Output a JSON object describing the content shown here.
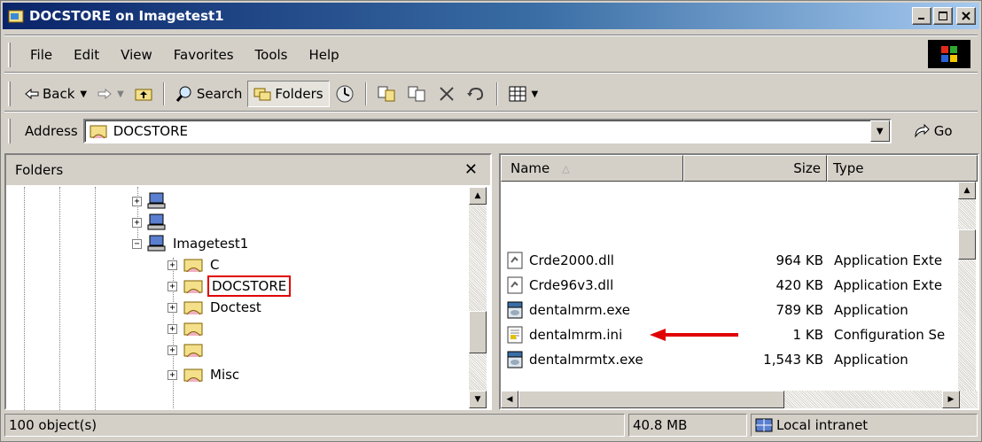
{
  "window": {
    "title": "DOCSTORE on Imagetest1"
  },
  "menu": [
    "File",
    "Edit",
    "View",
    "Favorites",
    "Tools",
    "Help"
  ],
  "toolbar": {
    "back": "Back",
    "search": "Search",
    "folders": "Folders"
  },
  "address": {
    "label": "Address",
    "value": "DOCSTORE",
    "go": "Go"
  },
  "folders": {
    "header": "Folders",
    "nodes": [
      {
        "label": "",
        "expander": "+",
        "icon": "computer-icon"
      },
      {
        "label": "",
        "expander": "+",
        "icon": "computer-icon"
      },
      {
        "label": "Imagetest1",
        "expander": "−",
        "icon": "computer-icon"
      },
      {
        "label": "C",
        "expander": "+",
        "icon": "shared-folder-icon"
      },
      {
        "label": "DOCSTORE",
        "expander": "+",
        "icon": "shared-folder-icon",
        "selected": true
      },
      {
        "label": "Doctest",
        "expander": "+",
        "icon": "shared-folder-icon"
      },
      {
        "label": "",
        "expander": "+",
        "icon": "shared-folder-icon"
      },
      {
        "label": "",
        "expander": "+",
        "icon": "shared-folder-icon"
      },
      {
        "label": "Misc",
        "expander": "+",
        "icon": "shared-folder-icon"
      }
    ]
  },
  "files": {
    "columns": {
      "name": "Name",
      "size": "Size",
      "type": "Type"
    },
    "rows": [
      {
        "name": "Crde2000.dll",
        "size": "964 KB",
        "type": "Application Exte",
        "icon": "dll-icon"
      },
      {
        "name": "Crde96v3.dll",
        "size": "420 KB",
        "type": "Application Exte",
        "icon": "dll-icon"
      },
      {
        "name": "dentalmrm.exe",
        "size": "789 KB",
        "type": "Application",
        "icon": "exe-icon"
      },
      {
        "name": "dentalmrm.ini",
        "size": "1 KB",
        "type": "Configuration Se",
        "icon": "ini-icon"
      },
      {
        "name": "dentalmrmtx.exe",
        "size": "1,543 KB",
        "type": "Application",
        "icon": "exe-icon"
      }
    ]
  },
  "status": {
    "objects": "100 object(s)",
    "size": "40.8 MB",
    "zone": "Local intranet"
  },
  "colors": {
    "titlebar_start": "#0a246a",
    "titlebar_end": "#a6caf0",
    "highlight": "#e00000",
    "chrome": "#d4d0c8"
  }
}
